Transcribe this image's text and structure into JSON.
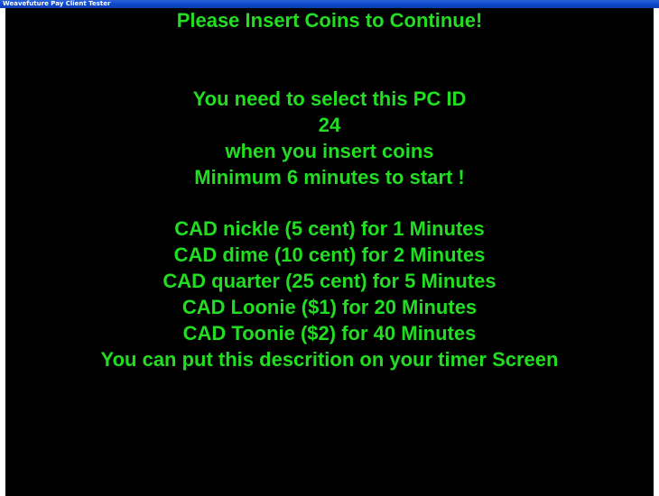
{
  "window": {
    "title": "Weavefuture Pay Client Tester"
  },
  "screen": {
    "heading": "Please Insert Coins to Continue!",
    "select_pc_line": "You need to select this PC ID",
    "pc_id": "24",
    "when_insert_line": "when you insert coins",
    "minimum_line": "Minimum 6 minutes to start !",
    "rates": [
      "CAD nickle (5 cent) for 1 Minutes",
      "CAD dime (10 cent) for 2 Minutes",
      "CAD quarter (25 cent) for 5 Minutes",
      "CAD Loonie ($1) for 20 Minutes",
      "CAD Toonie ($2) for 40 Minutes"
    ],
    "footer_line": "You can put this descrition on your timer Screen"
  },
  "colors": {
    "text": "#22dd22",
    "background": "#000000",
    "titlebar": "#0a46c8"
  }
}
